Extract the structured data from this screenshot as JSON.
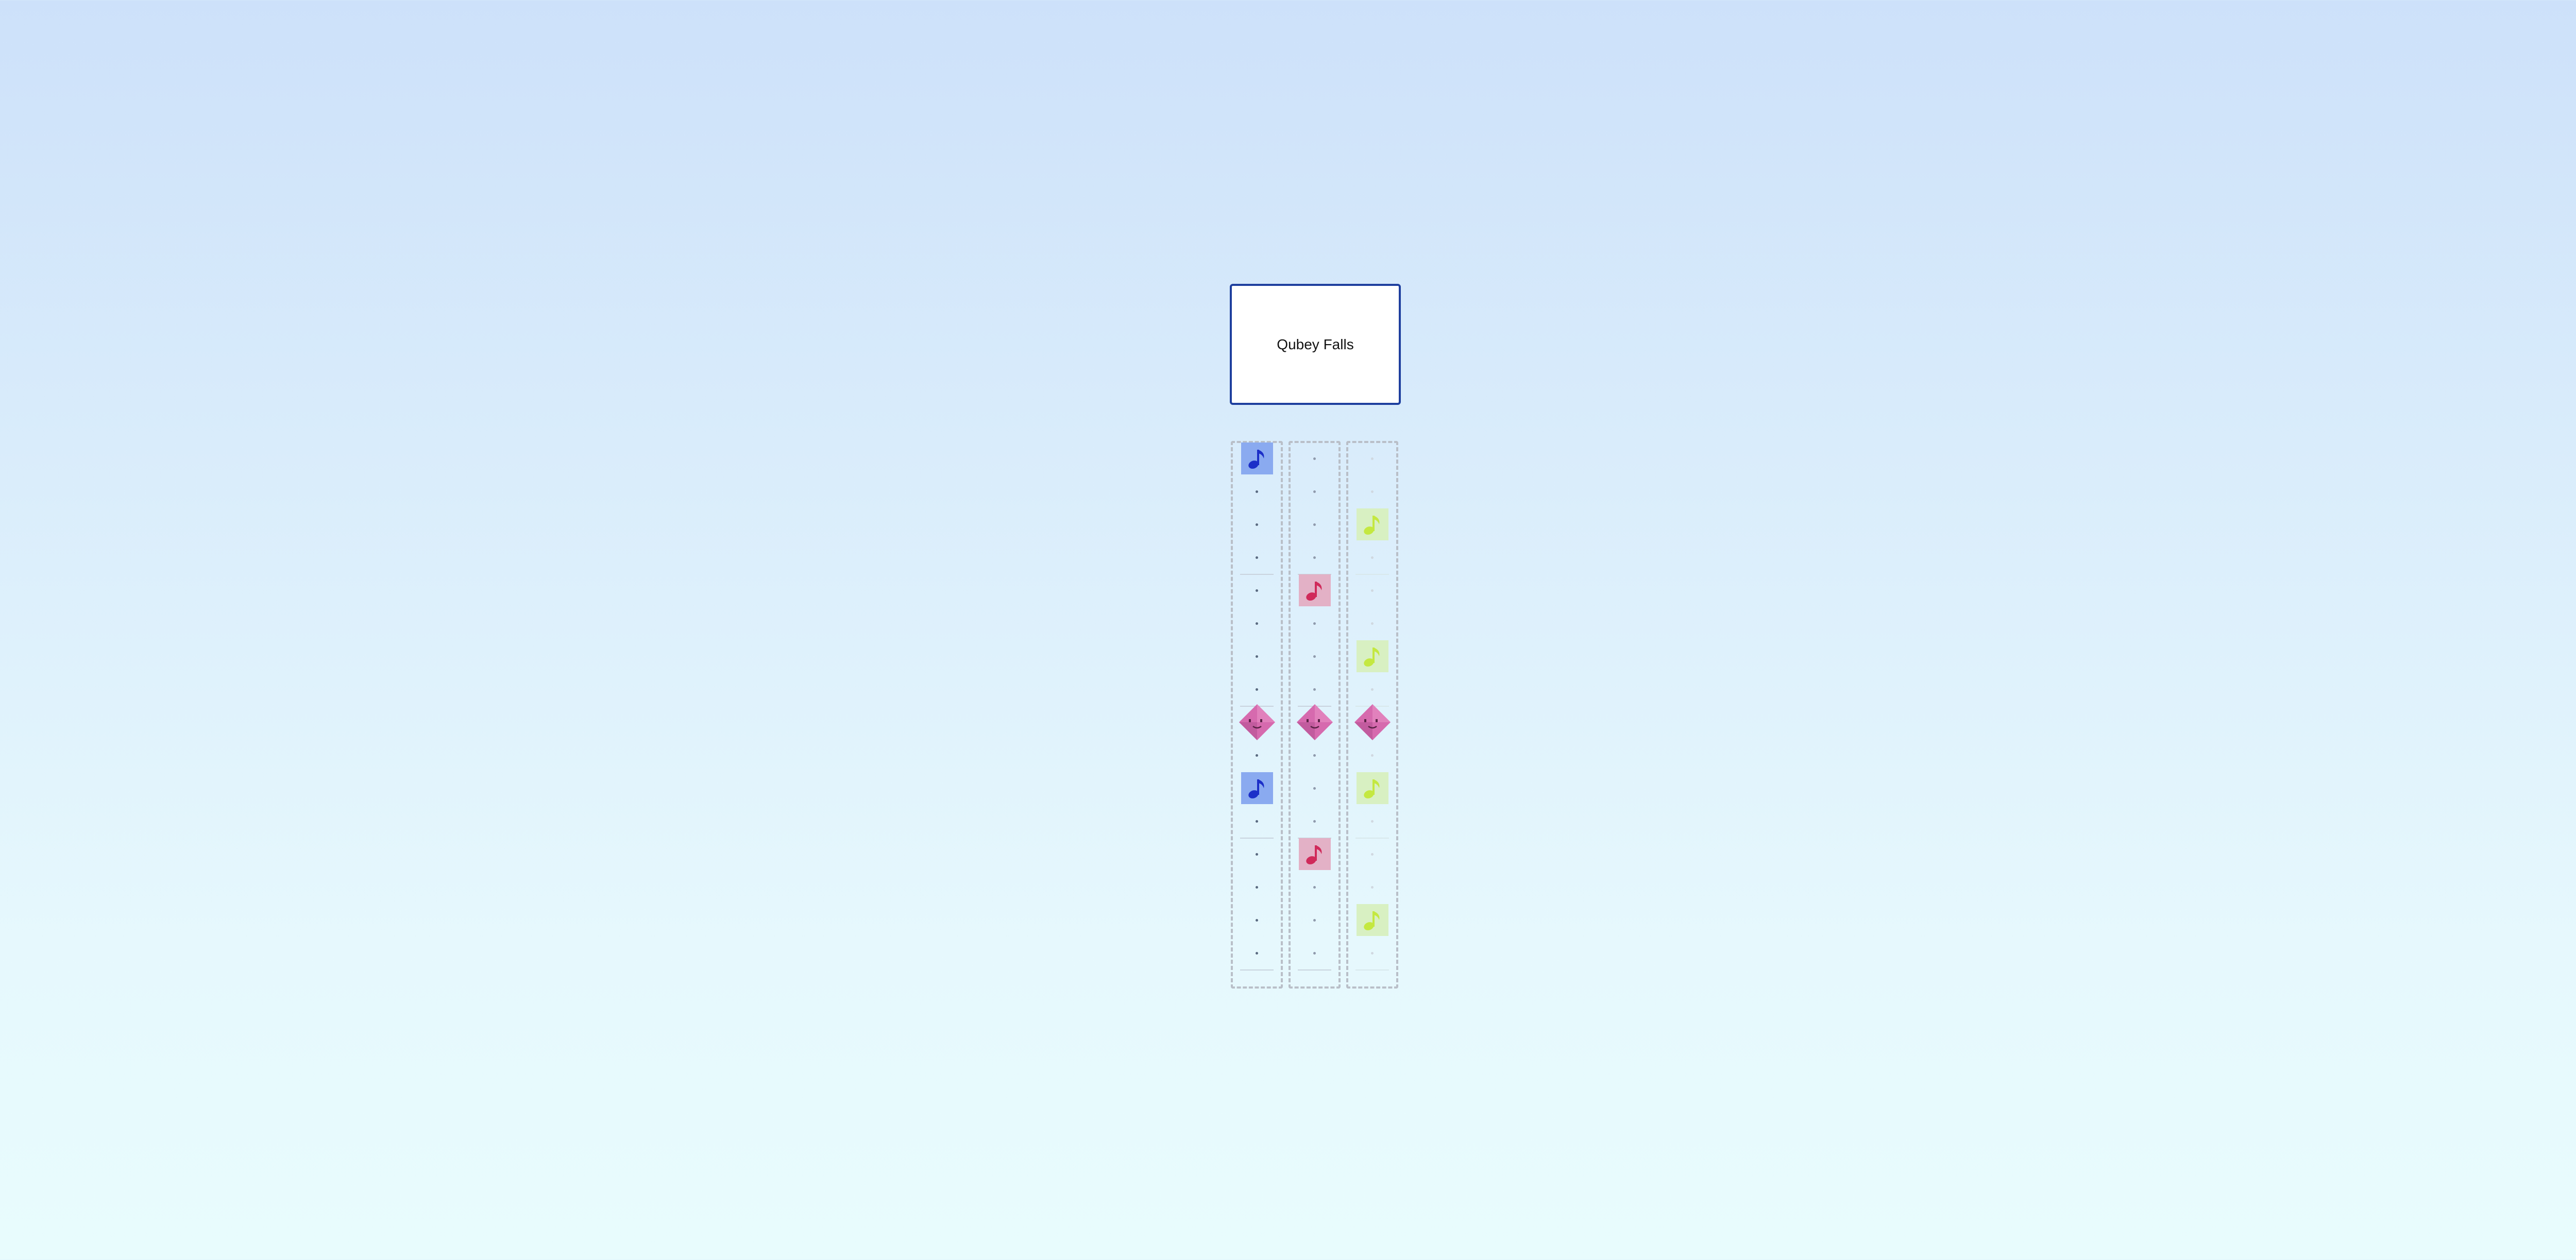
{
  "title": "Qubey Falls",
  "colors": {
    "background_top": "#cde1fa",
    "background_bottom": "#e8fcfd",
    "title_border": "#1e3f9e",
    "lane_border": "#b9bfc8",
    "note_blue": "#8aaaf0",
    "note_blue_glyph": "#1c2fc8",
    "note_pink": "#e3b1c6",
    "note_pink_glyph": "#d02a5a",
    "note_green": "#d8f0c2",
    "note_green_glyph": "#c4e840",
    "hit_target": "#d66aae"
  },
  "lanes": [
    {
      "name": "lane-1",
      "note_icon": "music-note-icon",
      "note_color": "blue",
      "notes_at_beats": [
        0,
        10
      ]
    },
    {
      "name": "lane-2",
      "note_icon": "music-note-icon",
      "note_color": "pink",
      "notes_at_beats": [
        4,
        12
      ]
    },
    {
      "name": "lane-3",
      "note_icon": "music-note-icon",
      "note_color": "green",
      "notes_at_beats": [
        2,
        6,
        10,
        14
      ]
    }
  ],
  "hit_target_beat": 8,
  "hit_target_icon": "cube-character-icon"
}
